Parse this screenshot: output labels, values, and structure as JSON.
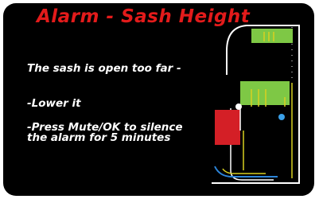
{
  "window": {
    "title": "Alarm - Sash Height"
  },
  "message": {
    "line1": "The sash is open too far -",
    "line2": "-Lower it",
    "line3": "-Press Mute/OK to silence the alarm for 5 minutes"
  },
  "diagram": {
    "description_icons": [
      "fume-hood-diagram",
      "sash-panel",
      "alarm-indicator",
      "airflow-arrows",
      "status-light"
    ],
    "colors": {
      "sash": "#7ec845",
      "alarm_block": "#d41f26",
      "airflow": "#d8d020",
      "outline": "#ffffff",
      "floor_flow": "#2c84d8",
      "status_light": "#3aa0e8"
    }
  }
}
